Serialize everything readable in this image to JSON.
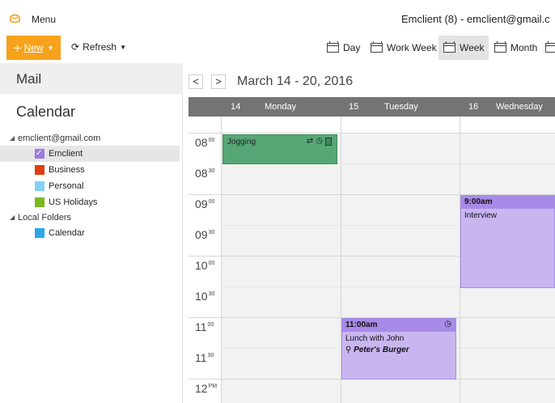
{
  "app": {
    "menu_label": "Menu",
    "window_title": "Emclient (8) - emclient@gmail.c"
  },
  "toolbar": {
    "new_label": "New",
    "refresh_label": "Refresh",
    "views": [
      {
        "label": "Day",
        "active": false
      },
      {
        "label": "Work Week",
        "active": false
      },
      {
        "label": "Week",
        "active": true
      },
      {
        "label": "Month",
        "active": false
      }
    ]
  },
  "sidebar": {
    "mail_title": "Mail",
    "calendar_title": "Calendar",
    "account_label": "emclient@gmail.com",
    "account_items": [
      {
        "label": "Emclient",
        "color": "#9b7be0",
        "checked": true,
        "selected": true
      },
      {
        "label": "Business",
        "color": "#e03e0f",
        "checked": false,
        "selected": false
      },
      {
        "label": "Personal",
        "color": "#82d1f2",
        "checked": false,
        "selected": false
      },
      {
        "label": "US Holidays",
        "color": "#7cb91c",
        "checked": false,
        "selected": false
      }
    ],
    "local_folders_label": "Local Folders",
    "local_items": [
      {
        "label": "Calendar",
        "color": "#2aa8e6",
        "checked": false,
        "selected": false
      }
    ]
  },
  "calendar": {
    "date_range": "March 14 - 20, 2016",
    "prev_glyph": "<",
    "next_glyph": ">",
    "days": [
      {
        "num": "14",
        "name": "Monday"
      },
      {
        "num": "15",
        "name": "Tuesday"
      },
      {
        "num": "16",
        "name": "Wednesday"
      }
    ],
    "time_slots": [
      {
        "hour": "08",
        "min": "00"
      },
      {
        "hour": "08",
        "min": "30"
      },
      {
        "hour": "09",
        "min": "00"
      },
      {
        "hour": "09",
        "min": "30"
      },
      {
        "hour": "10",
        "min": "00"
      },
      {
        "hour": "10",
        "min": "30"
      },
      {
        "hour": "11",
        "min": "00"
      },
      {
        "hour": "11",
        "min": "30"
      },
      {
        "hour": "12",
        "min": "PM"
      }
    ],
    "events": {
      "jogging": {
        "title": "Jogging"
      },
      "interview": {
        "time": "9:00am",
        "title": "Interview"
      },
      "lunch": {
        "time": "11:00am",
        "title": "Lunch with John",
        "location": "Peter's Burger"
      }
    }
  },
  "colors": {
    "accent_new": "#f7a21b",
    "event_green": "#56a775",
    "event_purple": "#c9b6f1",
    "header_gray": "#747474"
  }
}
